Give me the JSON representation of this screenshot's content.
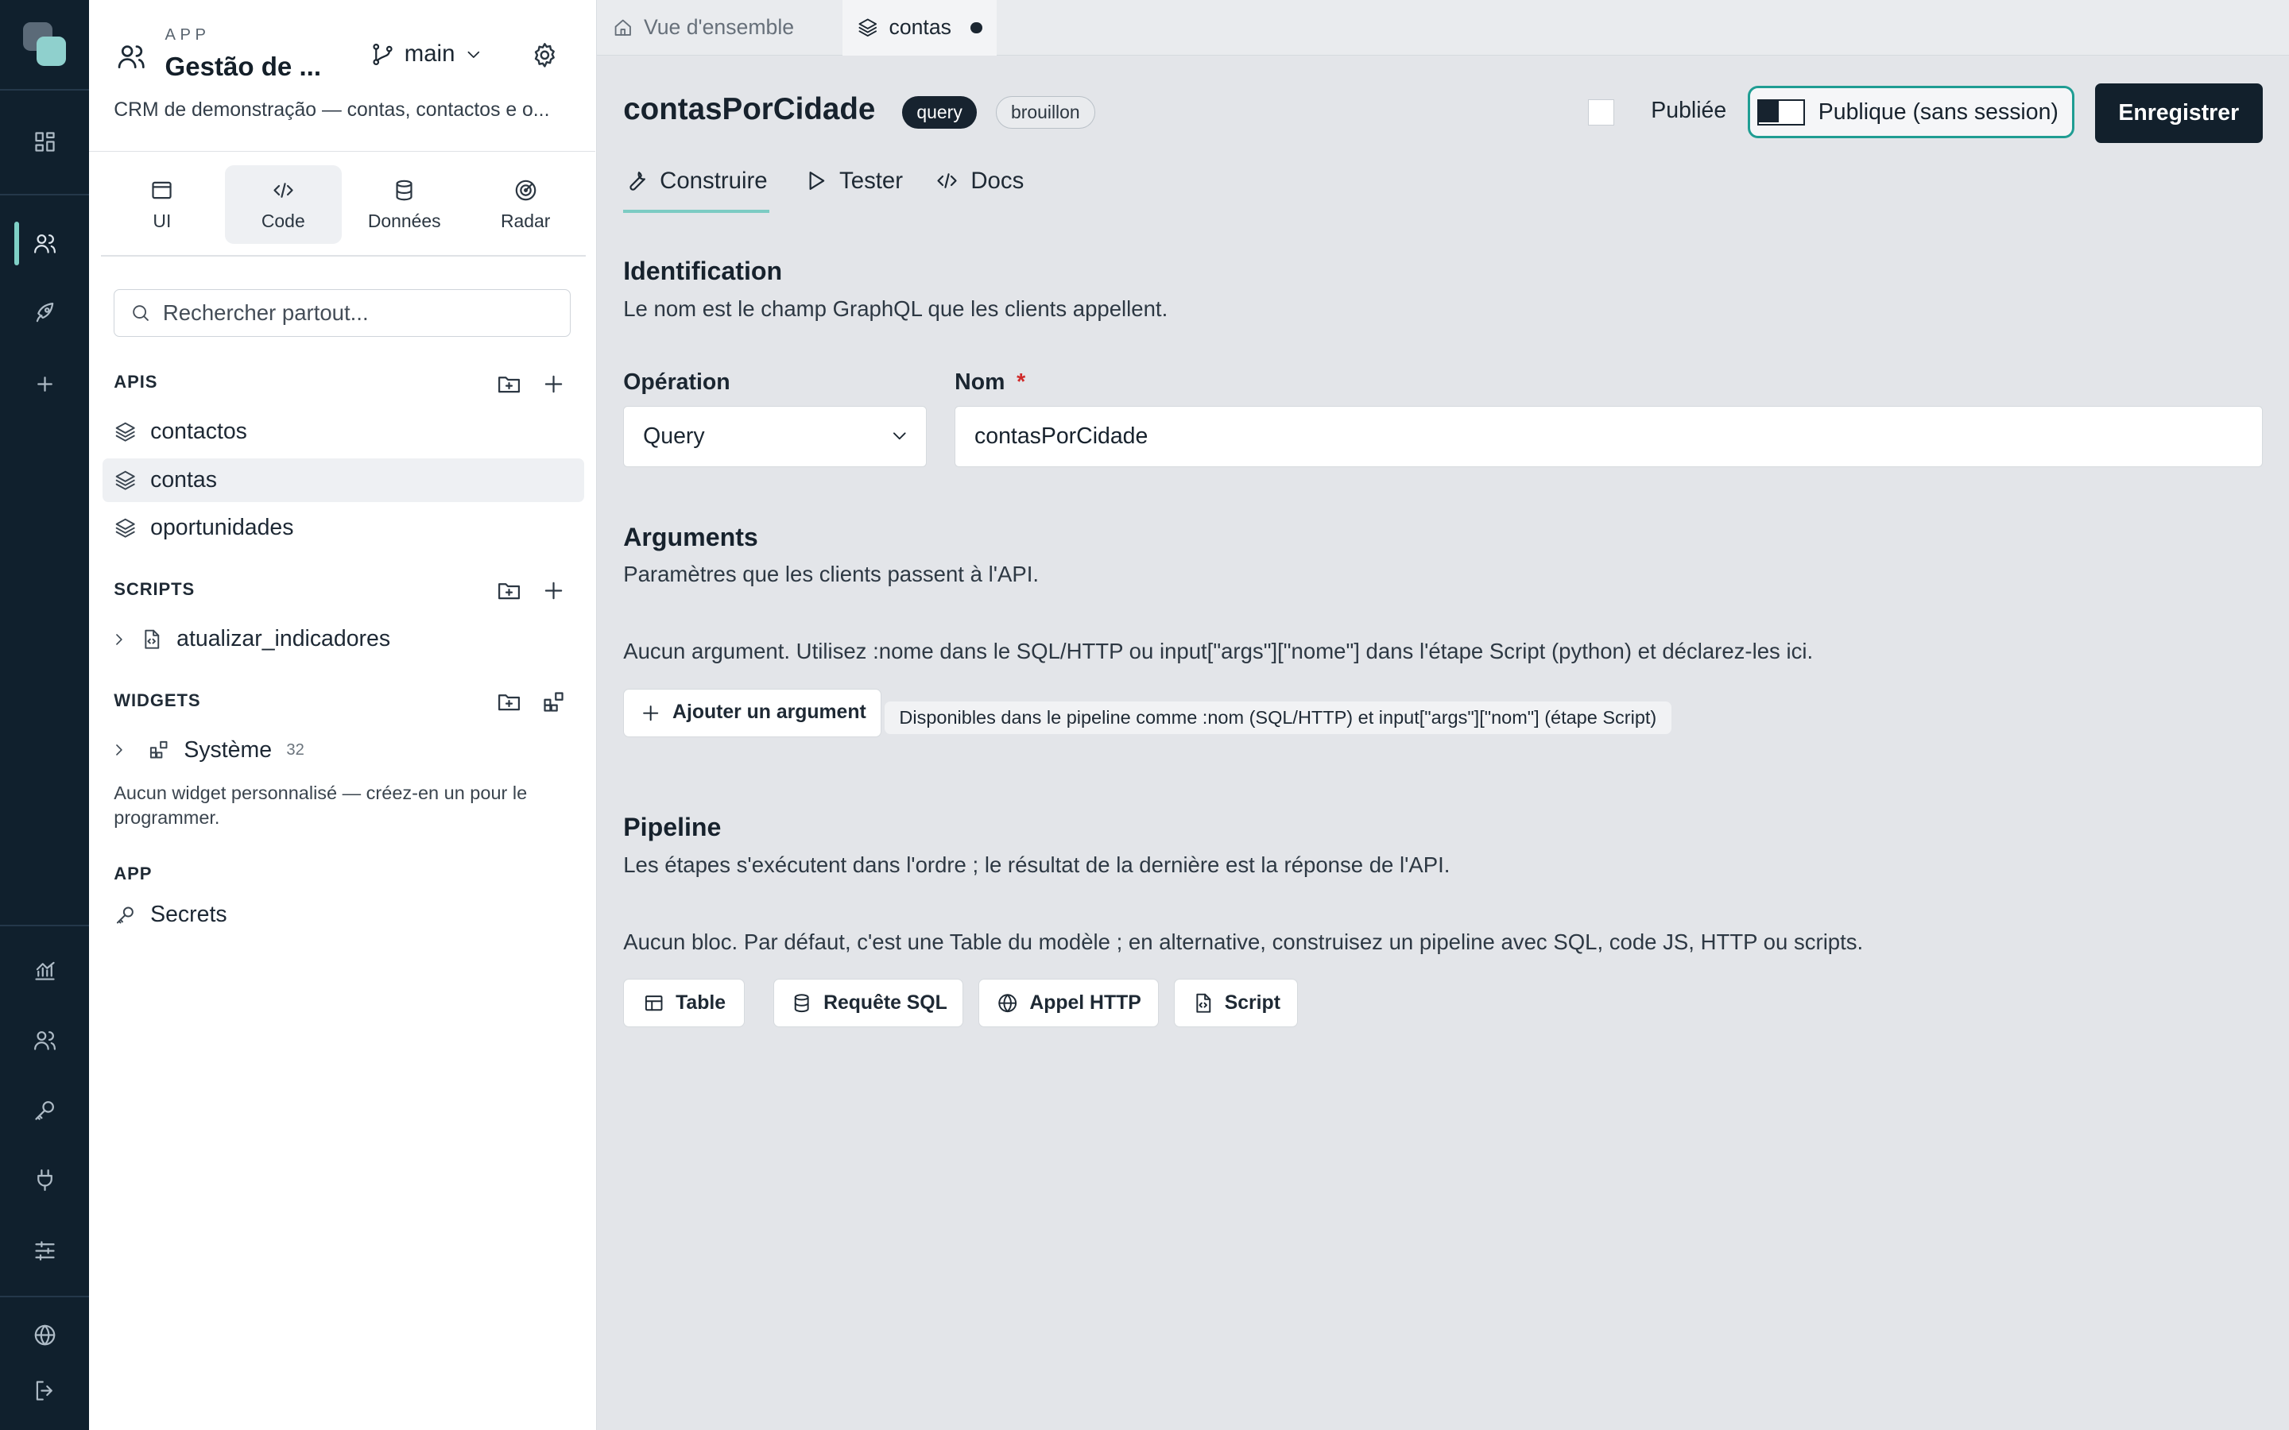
{
  "app": {
    "kicker": "APP",
    "title": "Gestão de ...",
    "branch": "main",
    "description": "CRM de demonstração — contas, contactos e o..."
  },
  "mode_tabs": [
    {
      "label": "UI",
      "icon": "window-icon"
    },
    {
      "label": "Code",
      "icon": "code-icon",
      "active": true
    },
    {
      "label": "Données",
      "icon": "database-icon"
    },
    {
      "label": "Radar",
      "icon": "radar-icon"
    }
  ],
  "search": {
    "placeholder": "Rechercher partout..."
  },
  "sections": {
    "apis": {
      "label": "APIS",
      "items": [
        {
          "label": "contactos"
        },
        {
          "label": "contas",
          "active": true
        },
        {
          "label": "oportunidades"
        }
      ]
    },
    "scripts": {
      "label": "SCRIPTS",
      "items": [
        {
          "label": "atualizar_indicadores"
        }
      ]
    },
    "widgets": {
      "label": "WIDGETS",
      "items": [
        {
          "label": "Système",
          "count": "32"
        }
      ],
      "empty_hint": "Aucun widget personnalisé — créez-en un pour le programmer."
    },
    "app": {
      "label": "APP",
      "items": [
        {
          "label": "Secrets"
        }
      ]
    }
  },
  "tabs": [
    {
      "label": "Vue d'ensemble",
      "icon": "home-icon"
    },
    {
      "label": "contas",
      "icon": "layers-icon",
      "active": true,
      "unsaved": true
    }
  ],
  "editor": {
    "name": "contasPorCidade",
    "badges": [
      "query",
      "brouillon"
    ],
    "published_label": "Publiée",
    "published": false,
    "public_label": "Publique (sans session)",
    "public": false,
    "save_label": "Enregistrer",
    "sub_tabs": [
      {
        "label": "Construire",
        "active": true
      },
      {
        "label": "Tester"
      },
      {
        "label": "Docs"
      }
    ],
    "identification": {
      "title": "Identification",
      "desc": "Le nom est le champ GraphQL que les clients appellent.",
      "operation_label": "Opération",
      "operation_value": "Query",
      "name_label": "Nom",
      "name_required_mark": "*",
      "name_value": "contasPorCidade"
    },
    "arguments": {
      "title": "Arguments",
      "desc": "Paramètres que les clients passent à l'API.",
      "empty": "Aucun argument. Utilisez :nome dans le SQL/HTTP ou input[\"args\"][\"nome\"] dans l'étape Script (python) et déclarez-les ici.",
      "add_label": "Ajouter un argument",
      "hint": "Disponibles dans le pipeline comme :nom (SQL/HTTP) et input[\"args\"][\"nom\"] (étape Script)"
    },
    "pipeline": {
      "title": "Pipeline",
      "desc": "Les étapes s'exécutent dans l'ordre ; le résultat de la dernière est la réponse de l'API.",
      "empty": "Aucun bloc. Par défaut, c'est une Table du modèle ; en alternative, construisez un pipeline avec SQL, code JS, HTTP ou scripts.",
      "blocks": [
        {
          "label": "Table",
          "icon": "table-icon"
        },
        {
          "label": "Requête SQL",
          "icon": "database-icon"
        },
        {
          "label": "Appel HTTP",
          "icon": "globe-icon"
        },
        {
          "label": "Script",
          "icon": "file-code-icon"
        }
      ]
    }
  },
  "colors": {
    "rail_bg": "#10202d",
    "accent": "#1f9d93",
    "primary_button": "#12202c",
    "required": "#d02a2a"
  }
}
